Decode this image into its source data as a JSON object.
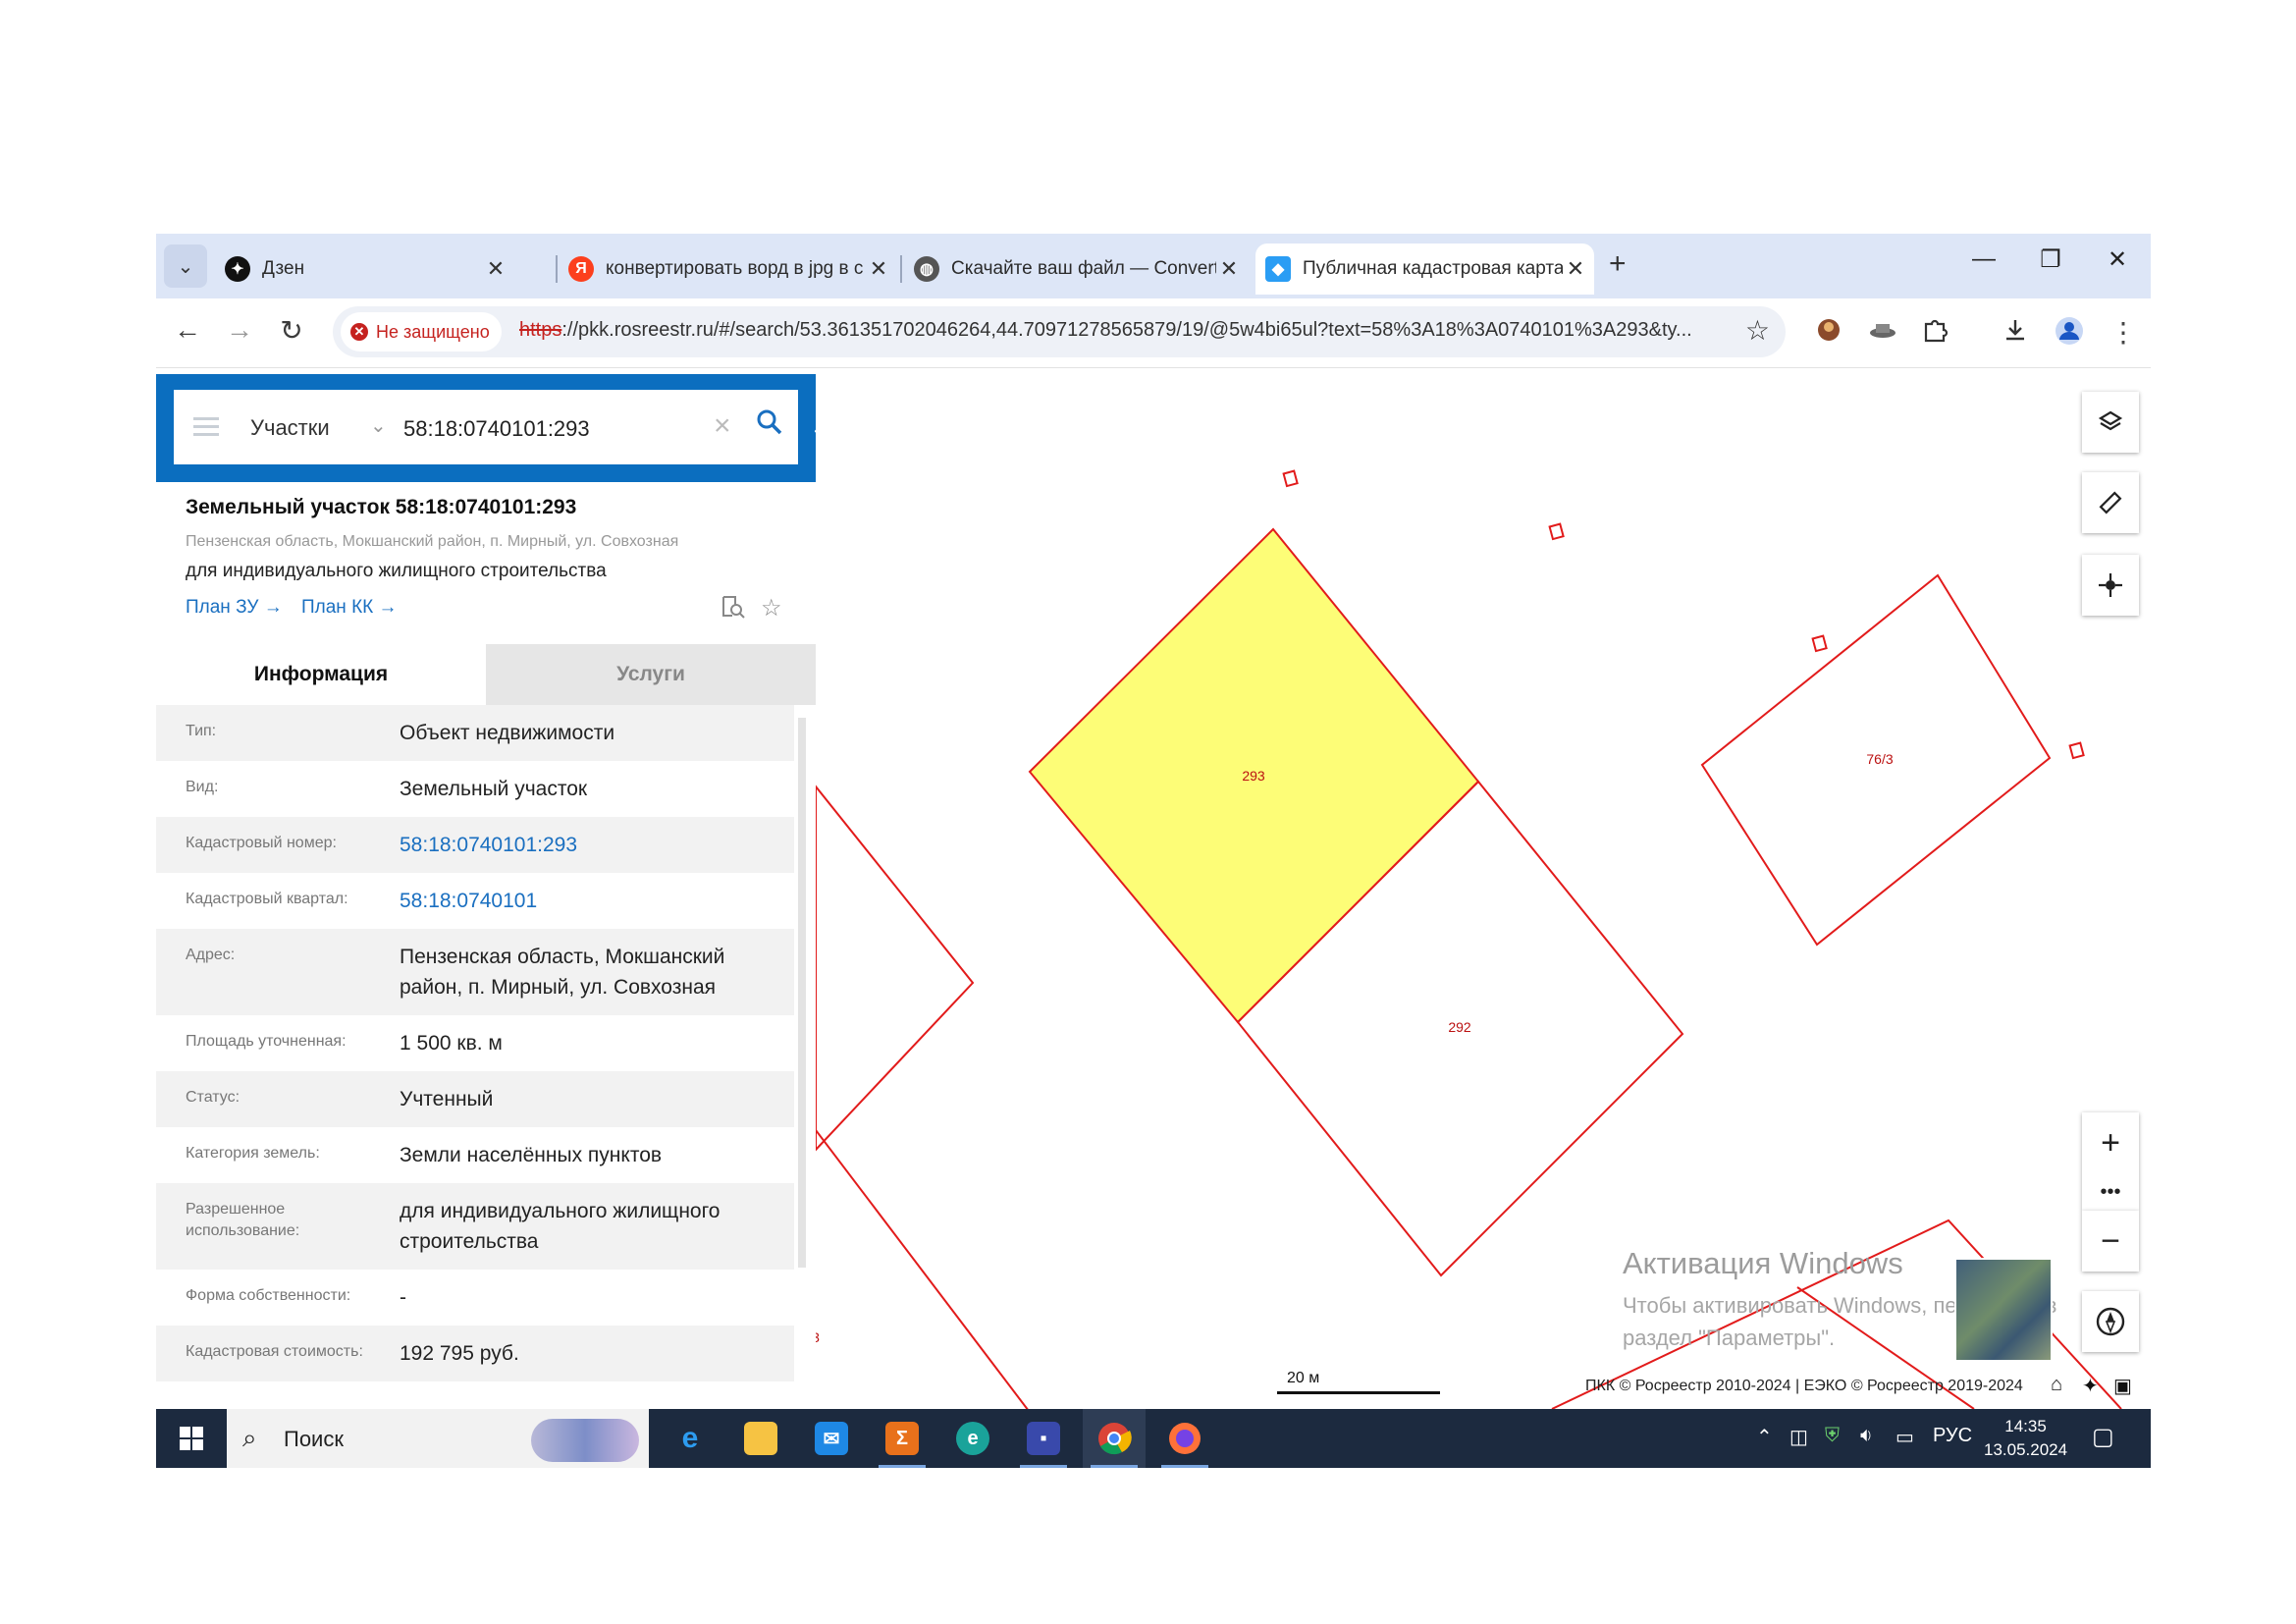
{
  "browser": {
    "tabs": [
      {
        "label": "Дзен",
        "icon": "dzen-icon"
      },
      {
        "label": "конвертировать ворд в jpg в с",
        "icon": "yandex-icon"
      },
      {
        "label": "Скачайте ваш файл — Convert",
        "icon": "globe-icon"
      },
      {
        "label": "Публичная кадастровая карта",
        "icon": "pkk-icon",
        "active": true
      }
    ],
    "security_label": "Не защищено",
    "url_scheme": "https",
    "url_rest": "://pkk.rosreestr.ru/#/search/53.361351702046264,44.70971278565879/19/@5w4bi65ul?text=58%3A18%3A0740101%3A293&ty..."
  },
  "search": {
    "type_label": "Участки",
    "query": "58:18:0740101:293"
  },
  "object": {
    "title": "Земельный участок 58:18:0740101:293",
    "address": "Пензенская область, Мокшанский район, п. Мирный, ул. Совхозная",
    "use": "для индивидуального жилищного строительства",
    "plan_zu": "План ЗУ →",
    "plan_kk": "План КК →"
  },
  "panel_tabs": {
    "info": "Информация",
    "services": "Услуги"
  },
  "info_rows": [
    {
      "key": "Тип:",
      "value": "Объект недвижимости"
    },
    {
      "key": "Вид:",
      "value": "Земельный участок"
    },
    {
      "key": "Кадастровый номер:",
      "value": "58:18:0740101:293"
    },
    {
      "key": "Кадастровый квартал:",
      "value": "58:18:0740101"
    },
    {
      "key": "Адрес:",
      "value": "Пензенская область, Мокшанский район, п. Мирный, ул. Совхозная"
    },
    {
      "key": "Площадь уточненная:",
      "value": "1 500 кв. м"
    },
    {
      "key": "Статус:",
      "value": "Учтенный"
    },
    {
      "key": "Категория земель:",
      "value": "Земли населённых пунктов"
    },
    {
      "key": "Разрешенное использование:",
      "value": "для индивидуального жилищного строительства"
    },
    {
      "key": "Форма собственности:",
      "value": "-"
    },
    {
      "key": "Кадастровая стоимость:",
      "value": "192 795 руб."
    }
  ],
  "map": {
    "parcel_labels": {
      "p293": "293",
      "p292": "292",
      "p763": "76/3",
      "edge": "3"
    },
    "scale_label": "20 м",
    "copyright": "ПКК © Росреестр 2010-2024 | ЕЭКО © Росреестр 2019-2024",
    "watermark_title": "Активация Windows",
    "watermark_line1": "Чтобы активировать Windows, перейдите в",
    "watermark_line2": "раздел \"Параметры\".",
    "selected_fill": "#fdfd77",
    "parcel_stroke": "#e21b1b"
  },
  "taskbar": {
    "search_label": "Поиск",
    "lang": "РУС",
    "time": "14:35",
    "date": "13.05.2024"
  }
}
